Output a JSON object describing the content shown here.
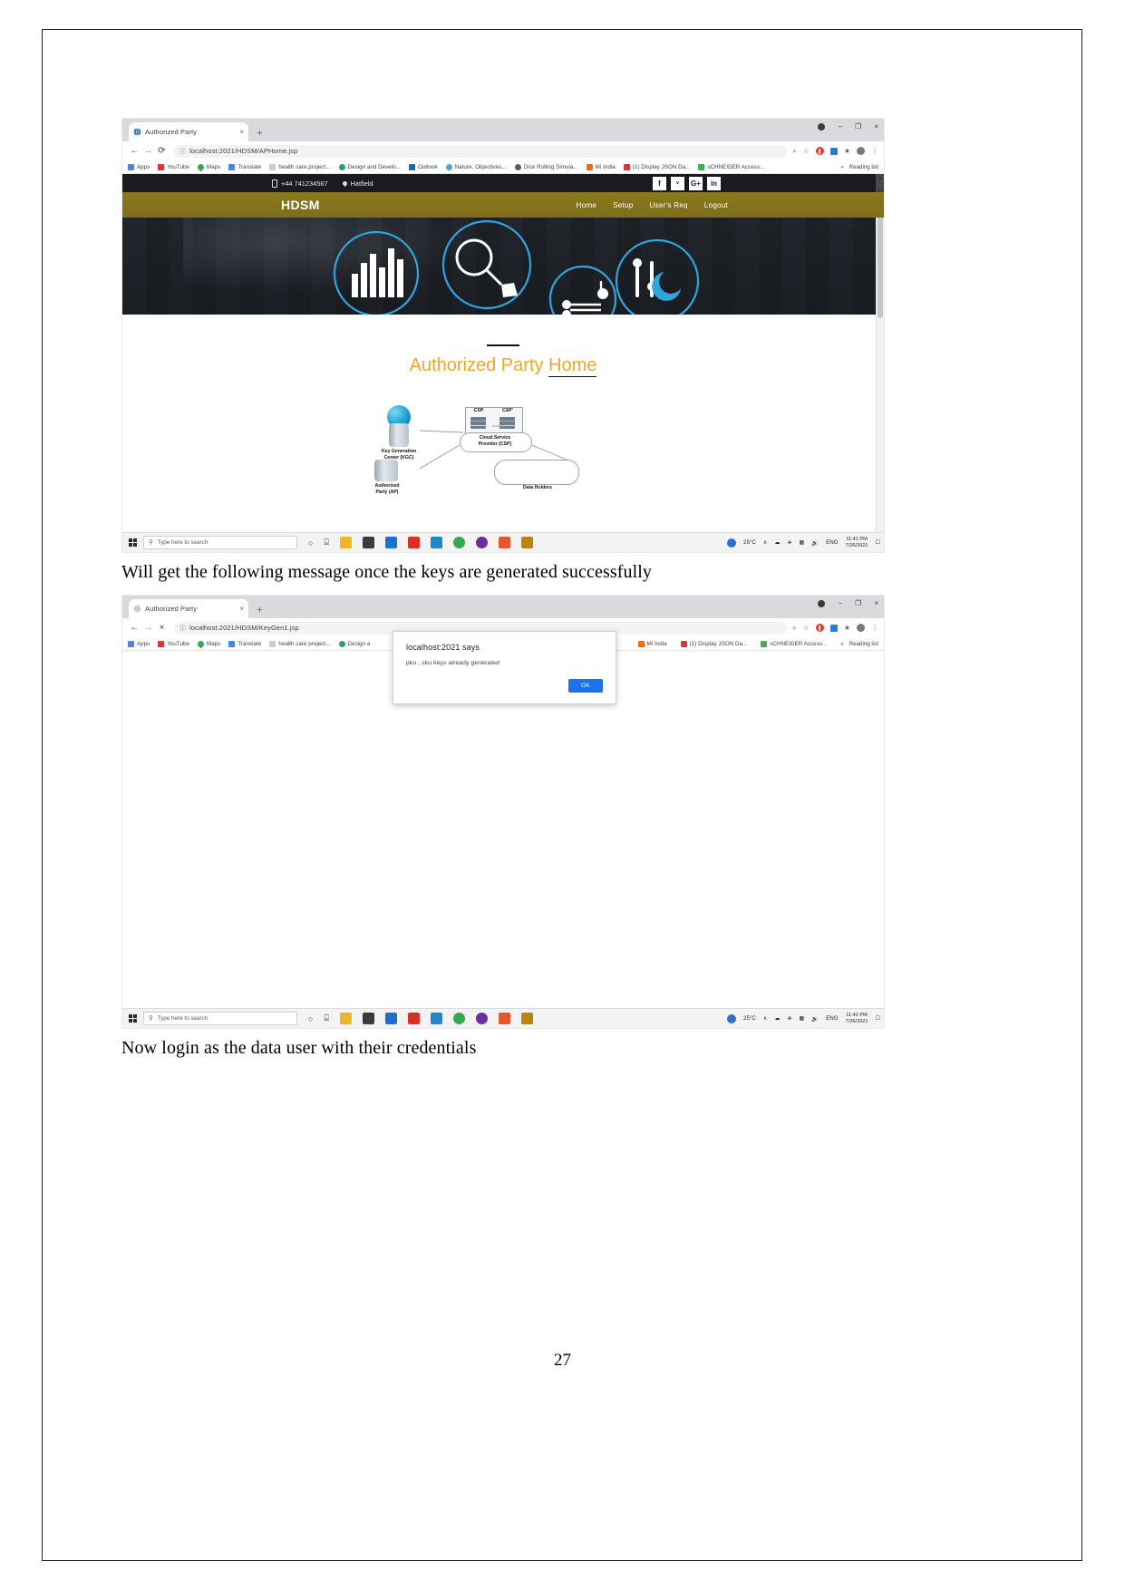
{
  "document": {
    "page_number": "27",
    "paragraph_1": "Will get the following message once the keys are generated successfully",
    "paragraph_2": "Now login as the data user with their credentials"
  },
  "browser_1": {
    "tab": {
      "title": "Authorized Party",
      "close": "×",
      "favicon_name": "globe-favicon"
    },
    "new_tab": "+",
    "window_controls": {
      "minimize": "−",
      "maximize": "❐",
      "close": "×"
    },
    "toolbar": {
      "back": "←",
      "forward": "→",
      "reload": "⟳",
      "url": "localhost:2021/HDSM/APHome.jsp",
      "info_icon": "ⓘ",
      "zoom_icon": "⌕",
      "bookmark_star": "☆",
      "menu": "⋮"
    },
    "bookmarks": [
      {
        "label": "Apps",
        "color": "#4285f4"
      },
      {
        "label": "YouTube",
        "color": "#e5322d"
      },
      {
        "label": "Maps",
        "color": "#34a853"
      },
      {
        "label": "Translate",
        "color": "#4285f4"
      },
      {
        "label": "health care project...",
        "color": "#c9cdd2"
      },
      {
        "label": "Design and Develo...",
        "color": "#2f9e6e"
      },
      {
        "label": "Outlook",
        "color": "#0f6cbd"
      },
      {
        "label": "Nature, Objectives...",
        "color": "#3fa9d8"
      },
      {
        "label": "Dice Rolling Simula...",
        "color": "#5c5c5c"
      },
      {
        "label": "Mi India",
        "color": "#ff6900"
      },
      {
        "label": "(1) Display JSON Da...",
        "color": "#e5322d"
      },
      {
        "label": "sCHNEIDER Access...",
        "color": "#3cb44b"
      }
    ],
    "bookmarks_overflow": "»",
    "reading_list": "Reading list"
  },
  "webpage": {
    "topbar": {
      "phone": "+44 741234567",
      "location": "Hatfield"
    },
    "social": [
      "f",
      "ᵛ",
      "G+",
      "in"
    ],
    "brand": "HDSM",
    "nav": [
      "Home",
      "Setup",
      "User's Req",
      "Logout"
    ],
    "title_orange": "Authorized Party",
    "title_underlined": "Home",
    "diagram": {
      "kgc": "Key Generation\nCenter (KGC)",
      "csp_left": "CSP",
      "csp_right": "CSP'",
      "csp_cloud": "Cloud Service\nProvider (CSP)",
      "ap": "Authorized\nParty (AP)",
      "data_holders": "Data Holders"
    }
  },
  "browser_2": {
    "tab": {
      "title": "Authorized Party",
      "close": "×",
      "favicon_name": "globe-favicon"
    },
    "new_tab": "+",
    "window_controls": {
      "minimize": "−",
      "maximize": "❐",
      "close": "×"
    },
    "toolbar": {
      "back": "←",
      "forward": "→",
      "stop": "×",
      "url": "localhost:2021/HDSM/KeyGen1.jsp",
      "info_icon": "ⓘ",
      "zoom_icon": "⌕",
      "bookmark_star": "☆",
      "menu": "⋮"
    },
    "bookmarks": [
      {
        "label": "Apps",
        "color": "#4285f4"
      },
      {
        "label": "YouTube",
        "color": "#e5322d"
      },
      {
        "label": "Maps",
        "color": "#34a853"
      },
      {
        "label": "Translate",
        "color": "#4285f4"
      },
      {
        "label": "health care project...",
        "color": "#c9cdd2"
      },
      {
        "label": "Design a",
        "color": "#2f9e6e"
      }
    ],
    "bookmarks_right": [
      {
        "label": "Mi India",
        "color": "#ff6900"
      },
      {
        "label": "(1) Display JSON Da...",
        "color": "#e5322d"
      },
      {
        "label": "sCHNEIDER Access...",
        "color": "#3cb44b"
      }
    ],
    "bookmarks_overflow": "»",
    "reading_list": "Reading list",
    "alert": {
      "title": "localhost:2021 says",
      "message": "pku , sku keys already generated",
      "ok_label": "OK"
    }
  },
  "taskbar_1": {
    "search_placeholder": "Type here to search",
    "search_icon": "⚲",
    "cortana_icon": "○",
    "taskview_icon": "⌸",
    "weather": "25°C",
    "language": "ENG",
    "time": "11:41 PM",
    "date": "7/26/2021",
    "chevron": "∧"
  },
  "taskbar_2": {
    "search_placeholder": "Type here to search",
    "search_icon": "⚲",
    "cortana_icon": "○",
    "taskview_icon": "⌸",
    "weather": "25°C",
    "language": "ENG",
    "time": "11:42 PM",
    "date": "7/26/2021",
    "chevron": "∧"
  },
  "colors": {
    "accent_orange": "#f0a52a",
    "nav_gold": "#8d7a1d",
    "alert_blue": "#1a73e8"
  }
}
